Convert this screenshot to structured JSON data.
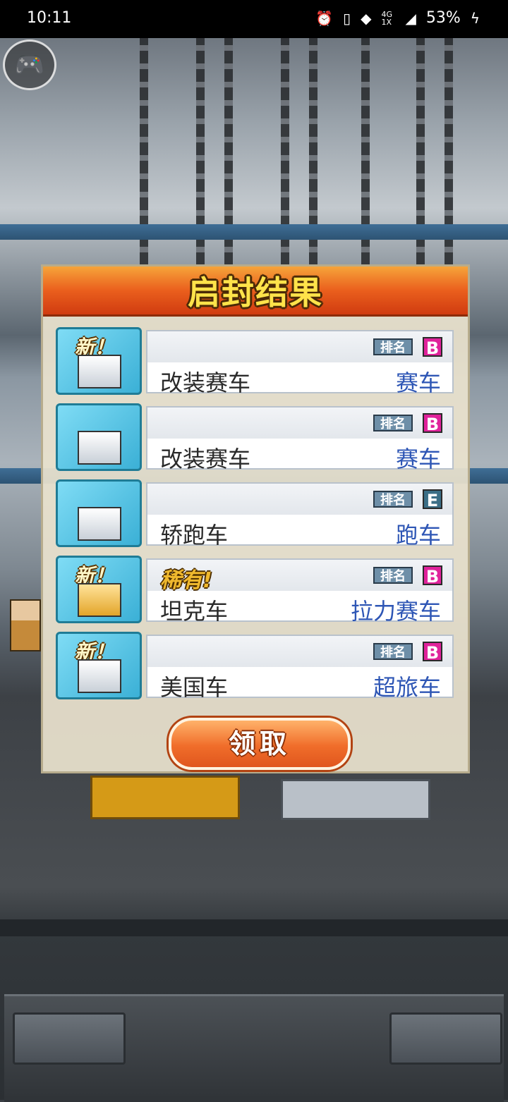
{
  "status_bar": {
    "time": "10:11",
    "network_label": "4G 1X",
    "battery_percent": "53%",
    "icons": [
      "alarm-icon",
      "phone-icon",
      "wifi-icon",
      "signal-icon",
      "charging-icon"
    ]
  },
  "overlay": {
    "gamepad_icon": "gamepad-icon"
  },
  "dialog": {
    "title": "启封结果",
    "rank_label": "排名",
    "items": [
      {
        "name": "改装赛车",
        "type": "赛车",
        "grade": "B",
        "new_badge": "新！",
        "rare_badge": ""
      },
      {
        "name": "改装赛车",
        "type": "赛车",
        "grade": "B",
        "new_badge": "",
        "rare_badge": ""
      },
      {
        "name": "轿跑车",
        "type": "跑车",
        "grade": "E",
        "new_badge": "",
        "rare_badge": ""
      },
      {
        "name": "坦克车",
        "type": "拉力赛车",
        "grade": "B",
        "new_badge": "新！",
        "rare_badge": "稀有!"
      },
      {
        "name": "美国车",
        "type": "超旅车",
        "grade": "B",
        "new_badge": "新！",
        "rare_badge": ""
      }
    ],
    "claim_button": "领取"
  },
  "colors": {
    "header_orange": "#ea5f1d",
    "title_yellow": "#ffe34a",
    "type_blue": "#2e56b5",
    "grade_pink": "#e0229b"
  }
}
